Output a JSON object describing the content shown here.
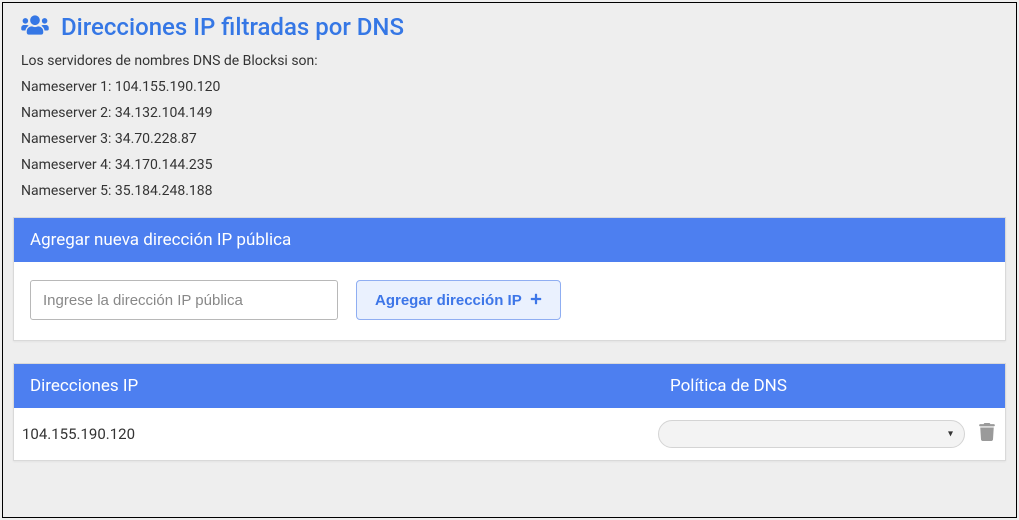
{
  "header": {
    "title": "Direcciones IP filtradas por DNS"
  },
  "intro": "Los servidores de nombres DNS de Blocksi son:",
  "nameservers": [
    {
      "label": "Nameserver 1: 104.155.190.120"
    },
    {
      "label": "Nameserver 2: 34.132.104.149"
    },
    {
      "label": "Nameserver 3: 34.70.228.87"
    },
    {
      "label": "Nameserver 4: 34.170.144.235"
    },
    {
      "label": "Nameserver 5: 35.184.248.188"
    }
  ],
  "addPanel": {
    "title": "Agregar nueva dirección IP pública",
    "placeholder": "Ingrese la dirección IP pública",
    "button": "Agregar dirección IP"
  },
  "table": {
    "headers": {
      "ip": "Direcciones IP",
      "policy": "Política de DNS"
    },
    "rows": [
      {
        "ip": "104.155.190.120",
        "policy": ""
      }
    ]
  }
}
